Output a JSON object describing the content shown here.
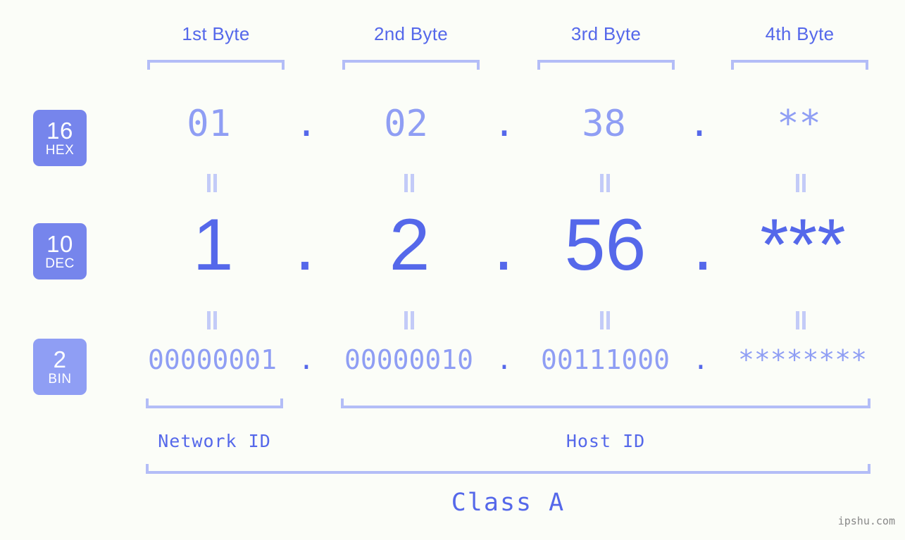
{
  "meta": {
    "background_color": "#fbfdf8",
    "accent_color": "#5568ea",
    "accent_light_color": "#8f9ef4",
    "bracket_color": "#b3bdf7",
    "badge_color": "#7685ec",
    "badge_light_color": "#8f9ef4",
    "watermark": "ipshu.com"
  },
  "byte_headers": [
    {
      "label": "1st Byte"
    },
    {
      "label": "2nd Byte"
    },
    {
      "label": "3rd Byte"
    },
    {
      "label": "4th Byte"
    }
  ],
  "radix_badges": [
    {
      "number": "16",
      "system": "HEX"
    },
    {
      "number": "10",
      "system": "DEC"
    },
    {
      "number": "2",
      "system": "BIN"
    }
  ],
  "rows": {
    "hex": {
      "values": [
        "01",
        "02",
        "38",
        "**"
      ],
      "separators": [
        ".",
        ".",
        "."
      ]
    },
    "dec": {
      "values": [
        "1",
        "2",
        "56",
        "***"
      ],
      "separators": [
        ".",
        ".",
        "."
      ]
    },
    "bin": {
      "values": [
        "00000001",
        "00000010",
        "00111000",
        "********"
      ],
      "separators": [
        ".",
        ".",
        "."
      ]
    }
  },
  "equals_separators": {
    "symbol": "=",
    "count_per_row": 4
  },
  "id_sections": [
    {
      "label": "Network ID"
    },
    {
      "label": "Host ID"
    }
  ],
  "class_section": {
    "label": "Class A"
  }
}
